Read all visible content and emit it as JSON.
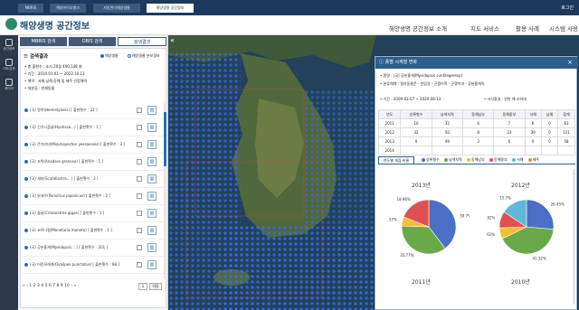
{
  "top_tabs": [
    "MBRIS",
    "해양바이오뱅크",
    "지방관리해양생물",
    "해양생명 공간정보"
  ],
  "top_right": "로그인",
  "logo_text": "해양생명 공간정보",
  "gnb": [
    "해양생명 공간정보 소개",
    "지도 서비스",
    "활용 사례",
    "시스템 사용"
  ],
  "gnb_button": "해양지도 선택",
  "leftbar": [
    "공간정보",
    "지도검색",
    "레이어"
  ],
  "panel_tabs": [
    "MBRIS 검색",
    "OBIS 검색",
    "검색결과"
  ],
  "result_title": "검색결과",
  "radio_options": [
    "해양생물",
    "해양생물 분포정보"
  ],
  "info_lines": [
    "• 총 출현수 : 조사 20점  400,148 회",
    "• 기간 : 2010.01.01 ~ 2022.10.13",
    "• 해역 : 서해,남해,동해 및 제주 인접해역",
    "• 대분류 : 연체동물"
  ],
  "list_items": [
    {
      "name": "(국) 명주(Hemistylosis)  [ 출현횟수 : 22 ]"
    },
    {
      "name": "(국) 긴가시참굴(Hyotissa...)  [ 출현횟수 : 1 ]"
    },
    {
      "name": "(국) 큰가리비(Mizuhopecten yessoensis)  [ 출현횟수 : 3 ]"
    },
    {
      "name": "(국) 꼬막(Anadara granosa)  [ 출현횟수 : 1 ]"
    },
    {
      "name": "(국) 세끼(Scutellastra... )  [ 출현횟수 : 2 ]"
    },
    {
      "name": "(국) 닭새우(Panulirus japonicus)  [ 출현횟수 : 2 ]"
    },
    {
      "name": "(국) 돌굴(Crassostrea gigas)  [ 출현횟수 : 1 ]"
    },
    {
      "name": "(국) 코르나필(Monetaria moneta)  [ 출현횟수 : 1 ]"
    },
    {
      "name": "(국) 공분홍게(Mysidopsis... )  [ 출현횟수 : 201 ]"
    },
    {
      "name": "(국) 어린모래게(Ovalipes punctatus)  [ 출현횟수 : 68 ]"
    }
  ],
  "pager": "« ‹ 1 2 3 4 5 6 7 8 9 10 › »",
  "page_box": "1",
  "page_go": "이동",
  "detail": {
    "title": "종별 시계열 변화",
    "lines": [
      "• 종명 :  (국) 공분홍게(Mysidopsis cuntilegeresp)",
      "• 분류체계 : 절지동물문 - 연갑강 - 곤쟁이목 - 곤쟁이과 - 공분홍게속",
      "• 기간 : 2009-03-07 ~ 2020-08-13",
      "• 서식환경 : 연안 해 조하대"
    ],
    "table_head": [
      "년도",
      "상록형수",
      "남색지역",
      "동해남부",
      "동해중부",
      "서해",
      "남해",
      "합계"
    ],
    "table_rows": [
      [
        "2011",
        "10",
        "32",
        "6",
        "7",
        "6",
        "0",
        "63"
      ],
      [
        "2012",
        "32",
        "50",
        "8",
        "23",
        "39",
        "0",
        "121"
      ],
      [
        "2013",
        "0",
        "49",
        "3",
        "6",
        "0",
        "0",
        "58"
      ],
      [
        "2014",
        "",
        "",
        "",
        "",
        "",
        "",
        ""
      ]
    ],
    "chart_tab": "연도별 채집 비율",
    "legend": [
      "상록형수",
      "남색지역",
      "동해남부",
      "동해중부",
      "서해",
      "제주"
    ]
  },
  "colors": {
    "blue": "#4a6fc4",
    "green": "#6aa94a",
    "yellow": "#f0c030",
    "red": "#e05050",
    "cyan": "#5fb8d8",
    "orange": "#f08a30"
  },
  "chart_data": [
    {
      "type": "pie",
      "title": "2013년",
      "labels": [
        "상록형수",
        "남색지역",
        "동해남부",
        "동해중부",
        "서해",
        "제주"
      ],
      "values": [
        39.7,
        35.77,
        5.57,
        18.96,
        0,
        0
      ]
    },
    {
      "type": "pie",
      "title": "2012년",
      "labels": [
        "상록형수",
        "남색지역",
        "동해남부",
        "동해중부",
        "서해",
        "제주"
      ],
      "values": [
        26.45,
        41.32,
        6.61,
        9.92,
        15.7,
        0
      ]
    },
    {
      "type": "pie",
      "title": "2011년",
      "labels": [],
      "values": []
    },
    {
      "type": "pie",
      "title": "2010년",
      "labels": [],
      "values": []
    }
  ]
}
